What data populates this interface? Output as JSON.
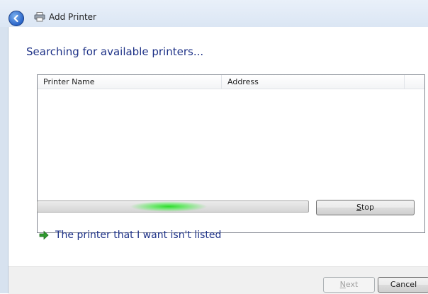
{
  "window": {
    "title": "Add Printer",
    "back_icon": "back-arrow-icon",
    "app_icon": "printer-icon"
  },
  "main": {
    "heading": "Searching for available printers...",
    "columns": [
      "Printer Name",
      "Address"
    ],
    "rows": [],
    "stop_label": "Stop",
    "stop_access_key": "S",
    "not_listed_link": "The printer that I want isn't listed",
    "not_listed_icon": "green-arrow-icon"
  },
  "footer": {
    "next_label": "Next",
    "next_access_key": "N",
    "cancel_label": "Cancel"
  },
  "colors": {
    "heading": "#1e3287",
    "progress_glow": "#2ddc2d",
    "header_bg": "#dbe6f4"
  }
}
